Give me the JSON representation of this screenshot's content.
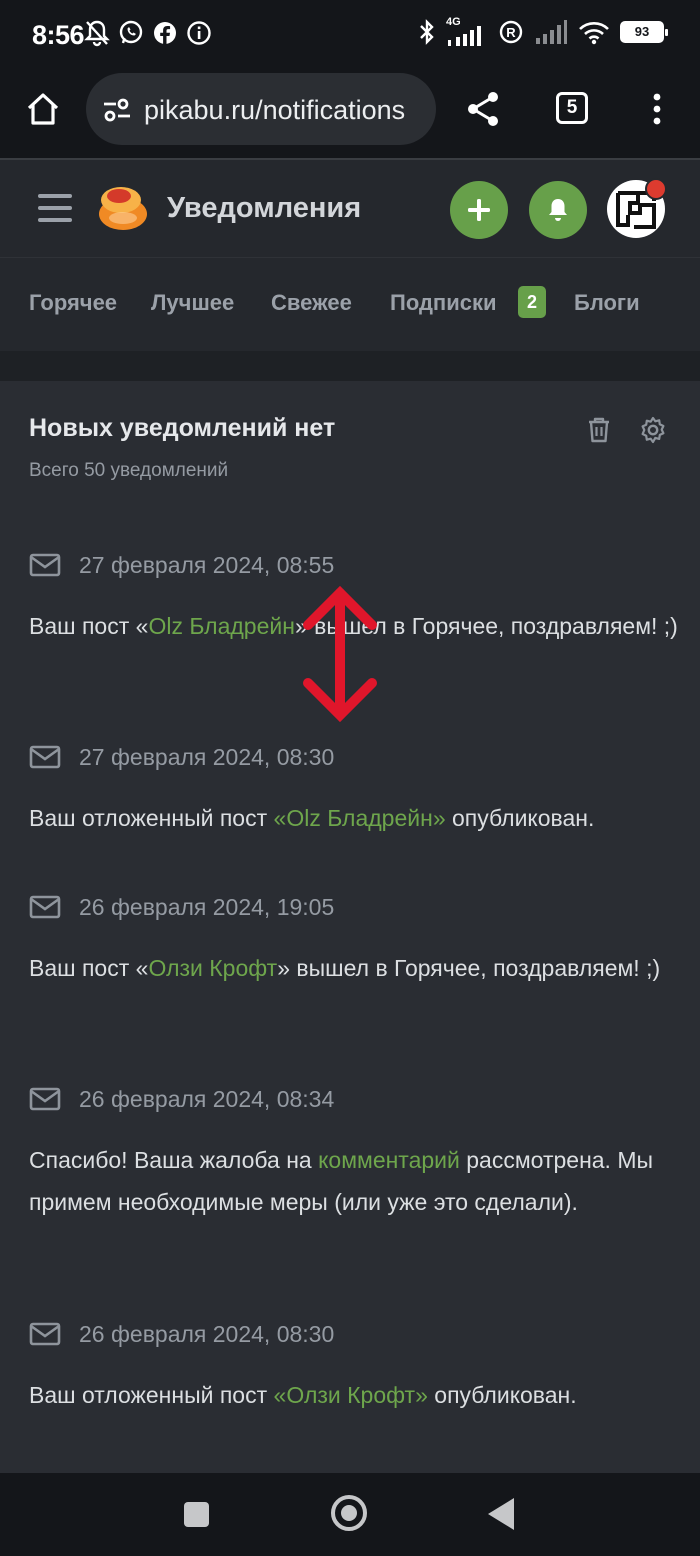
{
  "status_bar": {
    "time": "8:56",
    "network": "4G",
    "battery": "93"
  },
  "browser": {
    "url": "pikabu.ru/notifications",
    "tab_count": "5"
  },
  "header": {
    "title": "Уведомления",
    "accent_color": "#67a04a"
  },
  "nav": {
    "tabs": [
      {
        "label": "Горячее"
      },
      {
        "label": "Лучшее"
      },
      {
        "label": "Свежее"
      },
      {
        "label": "Подписки",
        "badge": "2"
      },
      {
        "label": "Блоги"
      }
    ]
  },
  "notifications_panel": {
    "title": "Новых уведомлений нет",
    "subtitle": "Всего 50 уведомлений",
    "items": [
      {
        "date": "27 февраля 2024, 08:55",
        "text_before": "Ваш пост «",
        "link": "Olz Бладрейн",
        "text_after": "» вышел в Горячее, поздравляем! ;)"
      },
      {
        "date": "27 февраля 2024, 08:30",
        "text_before": "Ваш отложенный пост ",
        "link": "«Olz Бладрейн»",
        "text_after": " опубликован."
      },
      {
        "date": "26 февраля 2024, 19:05",
        "text_before": "Ваш пост «",
        "link": "Олзи Крофт",
        "text_after": "» вышел в Горячее, поздравляем! ;)"
      },
      {
        "date": "26 февраля 2024, 08:34",
        "text_before": "Спасибо! Ваша жалоба на ",
        "link": "комментарий",
        "text_after": " рассмотрена. Мы примем необходимые меры (или уже это сделали)."
      },
      {
        "date": "26 февраля 2024, 08:30",
        "text_before": "Ваш отложенный пост ",
        "link": "«Олзи Крофт»",
        "text_after": " опубликован."
      }
    ]
  },
  "overlay": {
    "annotation_color": "#e0162b"
  }
}
